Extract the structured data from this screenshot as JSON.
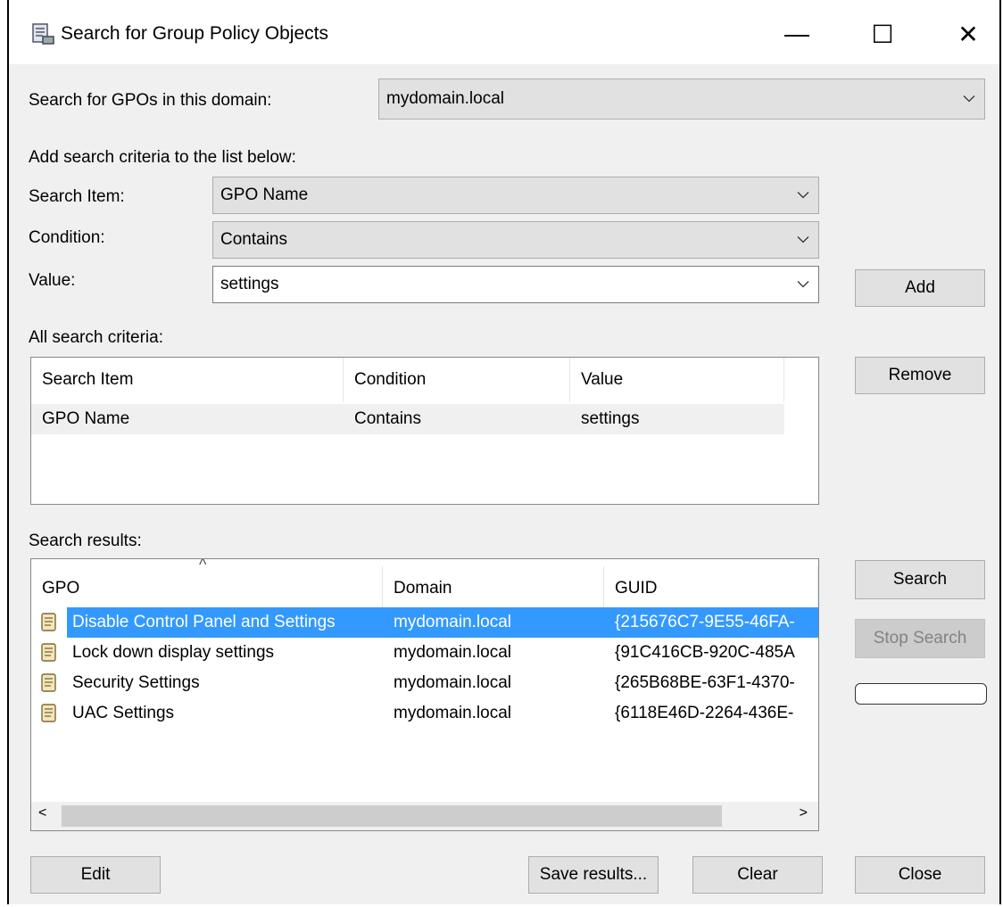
{
  "window": {
    "title": "Search for Group Policy Objects",
    "minimize_glyph": "—",
    "maximize_glyph": "☐",
    "close_glyph": "✕"
  },
  "domain": {
    "label": "Search for GPOs in this domain:",
    "value": "mydomain.local"
  },
  "criteria_form": {
    "intro": "Add search criteria to the list below:",
    "search_item_label": "Search Item:",
    "search_item_value": "GPO Name",
    "condition_label": "Condition:",
    "condition_value": "Contains",
    "value_label": "Value:",
    "value_value": "settings",
    "add_button": "Add"
  },
  "all_criteria": {
    "label": "All search criteria:",
    "columns": [
      "Search Item",
      "Condition",
      "Value"
    ],
    "rows": [
      [
        "GPO Name",
        "Contains",
        "settings"
      ]
    ],
    "remove_button": "Remove"
  },
  "results": {
    "label": "Search results:",
    "columns": [
      "GPO",
      "Domain",
      "GUID"
    ],
    "sort_indicator": "^",
    "rows": [
      {
        "gpo": "Disable Control Panel and Settings",
        "domain": "mydomain.local",
        "guid": "{215676C7-9E55-46FA-",
        "selected": true
      },
      {
        "gpo": "Lock down display settings",
        "domain": "mydomain.local",
        "guid": "{91C416CB-920C-485A",
        "selected": false
      },
      {
        "gpo": "Security Settings",
        "domain": "mydomain.local",
        "guid": "{265B68BE-63F1-4370-",
        "selected": false
      },
      {
        "gpo": "UAC Settings",
        "domain": "mydomain.local",
        "guid": "{6118E46D-2264-436E-",
        "selected": false
      }
    ],
    "scroll_left": "<",
    "scroll_right": ">",
    "search_button": "Search",
    "stop_search_button": "Stop Search",
    "progress": 0
  },
  "footer": {
    "edit_button": "Edit",
    "save_results_button": "Save results...",
    "clear_button": "Clear",
    "close_button": "Close"
  },
  "colors": {
    "selection": "#3399ff",
    "selection_text": "#ffffff",
    "row_highlight": "#f0f0f0",
    "button_face": "#e1e1e1"
  },
  "icons": {
    "window": "gpo-search-icon",
    "gpo": "gpo-scroll-icon"
  }
}
